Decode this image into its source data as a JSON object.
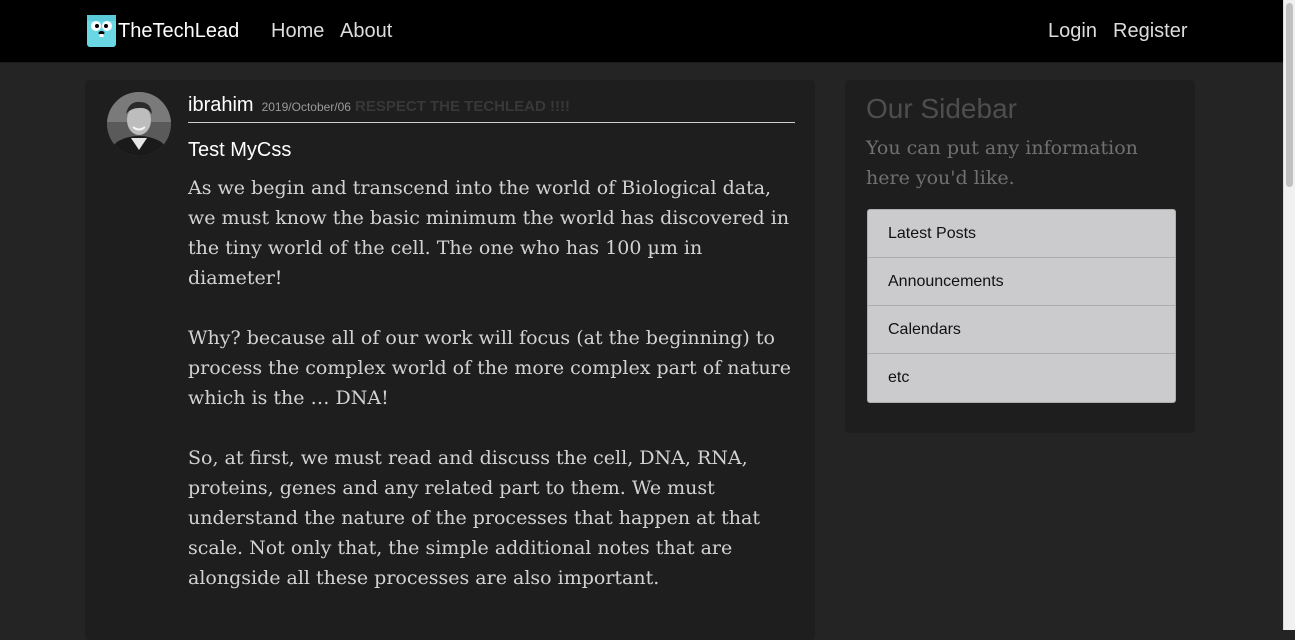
{
  "navbar": {
    "brand": "TheTechLead",
    "home": "Home",
    "about": "About",
    "login": "Login",
    "register": "Register"
  },
  "post": {
    "author": "ibrahim",
    "date": "2019/October/06",
    "tagline": "RESPECT THE TECHLEAD !!!!",
    "title": "Test MyCss",
    "paragraphs": [
      "As we begin and transcend into the world of Biological data, we must know the basic minimum the world has discovered in the tiny world of the cell. The one who has 100 µm in diameter!",
      "Why? because all of our work will focus (at the beginning) to process the complex world of the more complex part of nature which is the … DNA!",
      "So, at first, we must read and discuss the cell, DNA, RNA, proteins, genes and any related part to them. We must understand the nature of the processes that happen at that scale. Not only that, the simple additional notes that are alongside all these processes are also important."
    ]
  },
  "sidebar": {
    "title": "Our Sidebar",
    "text": "You can put any information here you'd like.",
    "items": [
      "Latest Posts",
      "Announcements",
      "Calendars",
      "etc"
    ]
  },
  "colors": {
    "navbar_bg": "#000000",
    "page_bg": "#242424",
    "card_bg": "#1e1e1e",
    "list_bg": "#cbcbcd"
  }
}
